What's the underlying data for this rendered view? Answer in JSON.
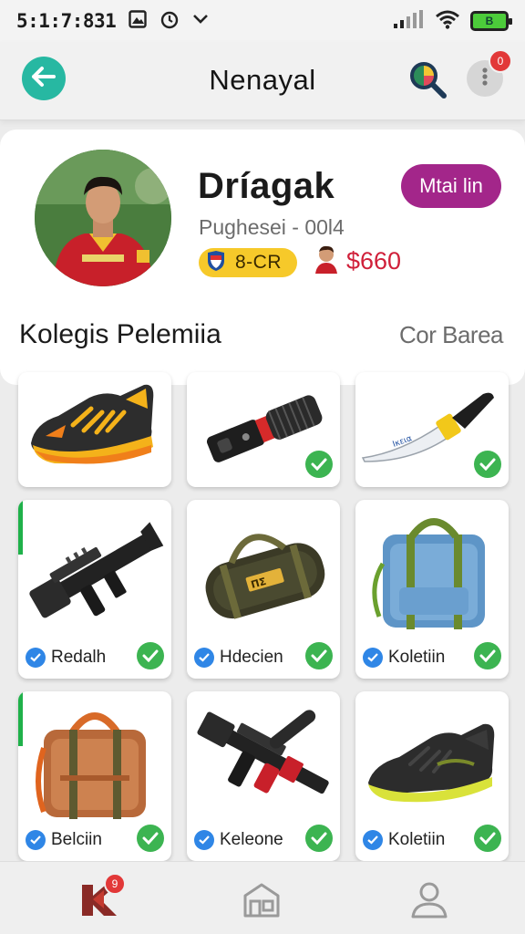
{
  "status_bar": {
    "time": "5:1:7:831",
    "battery_label": "B"
  },
  "app_bar": {
    "title": "Nenayal",
    "notification_count": "0"
  },
  "profile": {
    "name": "Dríagak",
    "subtitle": "Pughesei - 00l4",
    "follow_label": "Mtai lin",
    "rank_label": "8-CR",
    "coins": "$660"
  },
  "section": {
    "title": "Kolegis Pelemiia",
    "link": "Cor Barea"
  },
  "items": [
    {
      "icon": "sneaker-icon",
      "label": "",
      "checked": false
    },
    {
      "icon": "flashlight-icon",
      "label": "",
      "checked": true
    },
    {
      "icon": "knife-icon",
      "label": "",
      "checked": true
    },
    {
      "icon": "rifle-icon",
      "label": "Redalh",
      "checked": true
    },
    {
      "icon": "duffel-bag-icon",
      "label": "Hdecien",
      "checked": true
    },
    {
      "icon": "backpack-icon",
      "label": "Koletiin",
      "checked": true
    },
    {
      "icon": "brown-bag-icon",
      "label": "Belciin",
      "checked": true
    },
    {
      "icon": "assault-rifle-icon",
      "label": "Keleone",
      "checked": true
    },
    {
      "icon": "running-shoe-icon",
      "label": "Koletiin",
      "checked": true
    }
  ],
  "bottom_nav": {
    "home_badge": "9"
  },
  "colors": {
    "accent_teal": "#27b8a2",
    "follow_purple": "#a3268a",
    "check_green": "#3cb451",
    "verify_blue": "#2f86e6",
    "coin_red": "#d0203a",
    "rank_yellow": "#f6c92a"
  }
}
